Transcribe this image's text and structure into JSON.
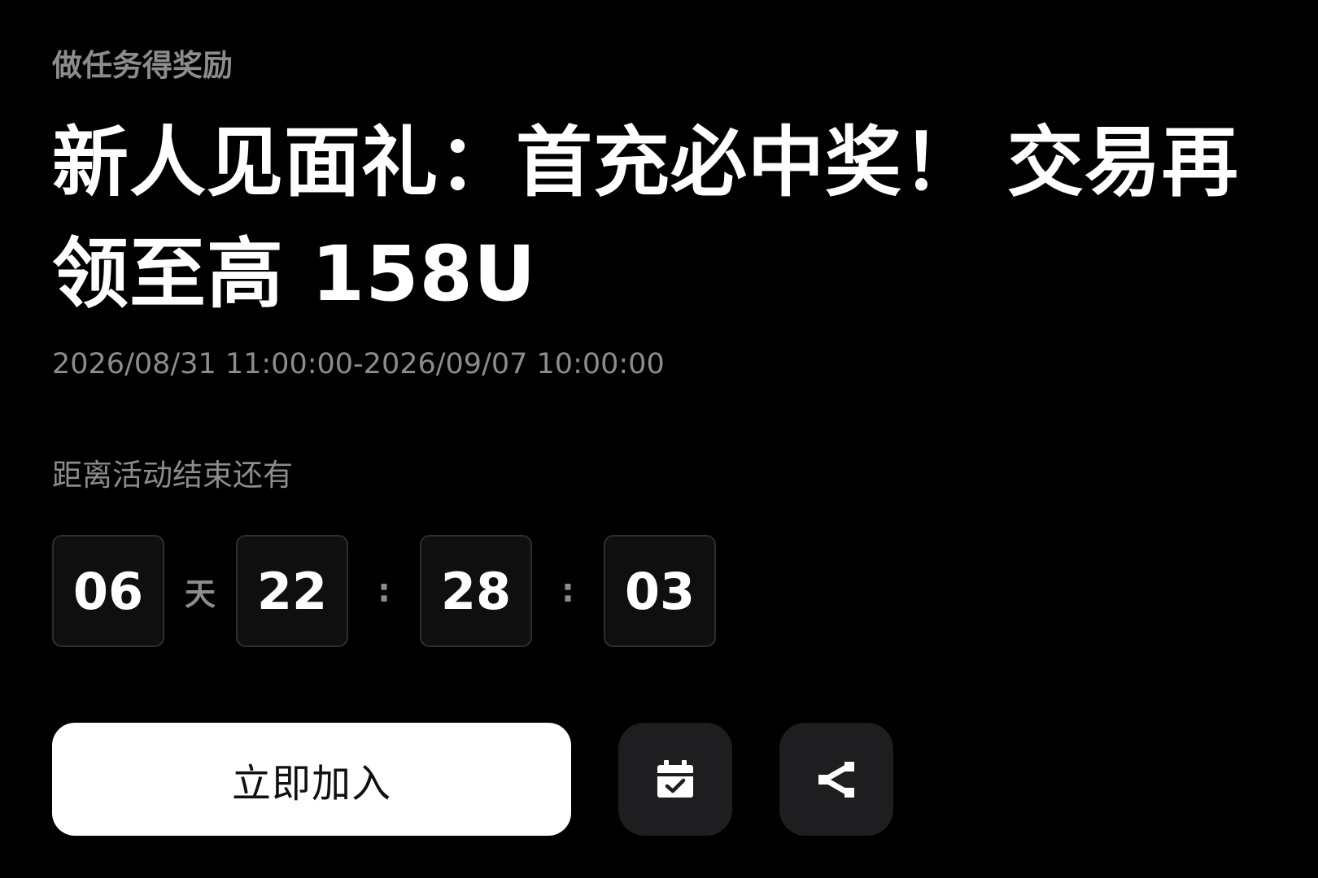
{
  "header": {
    "subtitle": "做任务得奖励",
    "title": "新人见面礼：首充必中奖！ 交易再领至高 158U",
    "date_range": "2026/08/31 11:00:00-2026/09/07 10:00:00"
  },
  "countdown": {
    "label": "距离活动结束还有",
    "days": "06",
    "days_unit": "天",
    "hours": "22",
    "minutes": "28",
    "seconds": "03",
    "separator": ":"
  },
  "actions": {
    "join_label": "立即加入",
    "calendar_icon": "calendar-check-icon",
    "share_icon": "share-icon"
  },
  "colors": {
    "background": "#000000",
    "muted_text": "#8c8c8c",
    "primary_button": "#ffffff",
    "icon_button": "#1e1e20"
  }
}
